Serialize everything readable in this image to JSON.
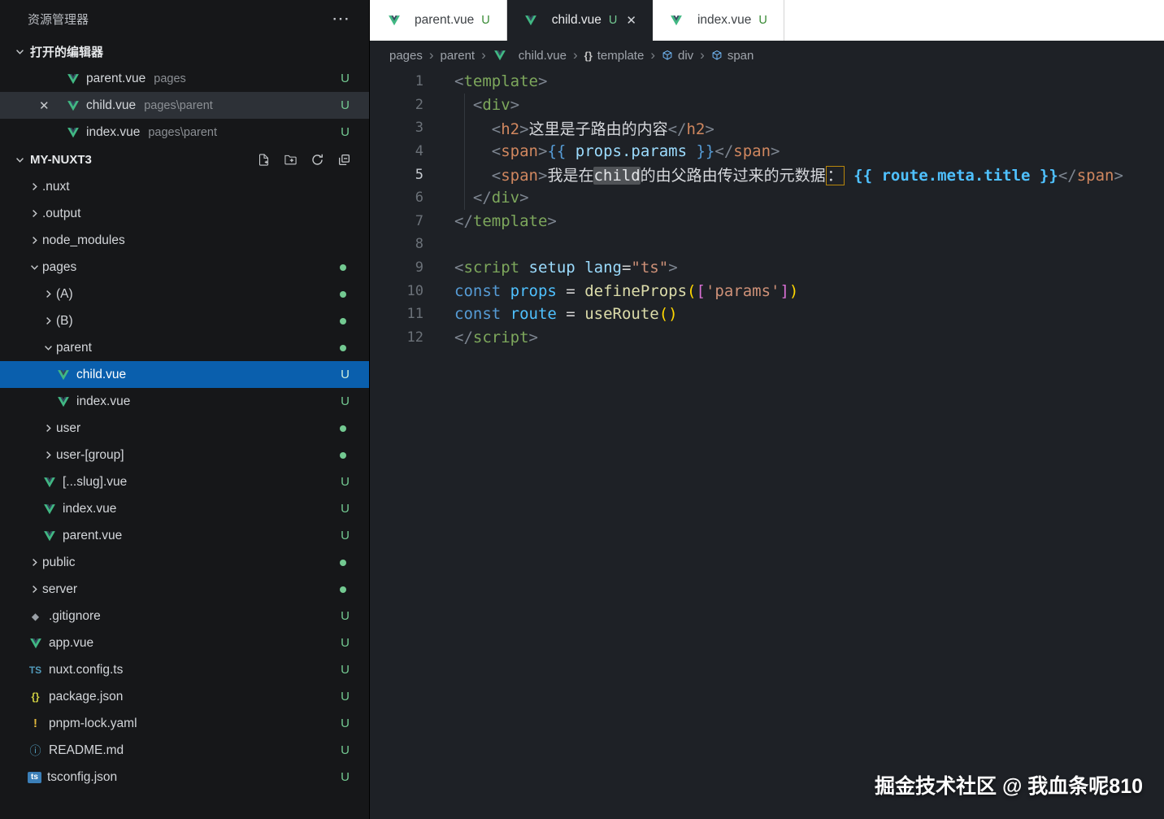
{
  "icons": {
    "close": "✕",
    "more": "⋯",
    "braces": "{}",
    "separator": "›"
  },
  "sidebar": {
    "title": "资源管理器",
    "open_editors": {
      "label": "打开的编辑器",
      "items": [
        {
          "file": "parent.vue",
          "path": "pages",
          "badge": "U",
          "selected": false
        },
        {
          "file": "child.vue",
          "path": "pages\\parent",
          "badge": "U",
          "selected": true
        },
        {
          "file": "index.vue",
          "path": "pages\\parent",
          "badge": "U",
          "selected": false
        }
      ]
    },
    "project": {
      "label": "MY-NUXT3",
      "actions": [
        "new-file-icon",
        "new-folder-icon",
        "refresh-icon",
        "collapse-all-icon"
      ],
      "tree": [
        {
          "label": ".nuxt",
          "kind": "folder",
          "expanded": false,
          "indent": 0
        },
        {
          "label": ".output",
          "kind": "folder",
          "expanded": false,
          "indent": 0
        },
        {
          "label": "node_modules",
          "kind": "folder",
          "expanded": false,
          "indent": 0
        },
        {
          "label": "pages",
          "kind": "folder",
          "expanded": true,
          "indent": 0,
          "badge": "dot"
        },
        {
          "label": "(A)",
          "kind": "folder",
          "expanded": false,
          "indent": 1,
          "badge": "dot"
        },
        {
          "label": "(B)",
          "kind": "folder",
          "expanded": false,
          "indent": 1,
          "badge": "dot"
        },
        {
          "label": "parent",
          "kind": "folder",
          "expanded": true,
          "indent": 1,
          "badge": "dot"
        },
        {
          "label": "child.vue",
          "kind": "file",
          "icon": "vue",
          "indent": 2,
          "badge": "U",
          "selected": true
        },
        {
          "label": "index.vue",
          "kind": "file",
          "icon": "vue",
          "indent": 2,
          "badge": "U"
        },
        {
          "label": "user",
          "kind": "folder",
          "expanded": false,
          "indent": 1,
          "badge": "dot"
        },
        {
          "label": "user-[group]",
          "kind": "folder",
          "expanded": false,
          "indent": 1,
          "badge": "dot"
        },
        {
          "label": "[...slug].vue",
          "kind": "file",
          "icon": "vue",
          "indent": 1,
          "badge": "U"
        },
        {
          "label": "index.vue",
          "kind": "file",
          "icon": "vue",
          "indent": 1,
          "badge": "U"
        },
        {
          "label": "parent.vue",
          "kind": "file",
          "icon": "vue",
          "indent": 1,
          "badge": "U"
        },
        {
          "label": "public",
          "kind": "folder",
          "expanded": false,
          "indent": 0,
          "badge": "dot"
        },
        {
          "label": "server",
          "kind": "folder",
          "expanded": false,
          "indent": 0,
          "badge": "dot"
        },
        {
          "label": ".gitignore",
          "kind": "file",
          "icon": "git",
          "indent": 0,
          "badge": "U"
        },
        {
          "label": "app.vue",
          "kind": "file",
          "icon": "vue",
          "indent": 0,
          "badge": "U"
        },
        {
          "label": "nuxt.config.ts",
          "kind": "file",
          "icon": "ts",
          "indent": 0,
          "badge": "U"
        },
        {
          "label": "package.json",
          "kind": "file",
          "icon": "json",
          "indent": 0,
          "badge": "U"
        },
        {
          "label": "pnpm-lock.yaml",
          "kind": "file",
          "icon": "yaml",
          "indent": 0,
          "badge": "U"
        },
        {
          "label": "README.md",
          "kind": "file",
          "icon": "readme",
          "indent": 0,
          "badge": "U"
        },
        {
          "label": "tsconfig.json",
          "kind": "file",
          "icon": "tsconfig",
          "indent": 0,
          "badge": "U"
        }
      ]
    }
  },
  "tabs": [
    {
      "file": "parent.vue",
      "badge": "U",
      "active": false,
      "closable": false
    },
    {
      "file": "child.vue",
      "badge": "U",
      "active": true,
      "closable": true
    },
    {
      "file": "index.vue",
      "badge": "U",
      "active": false,
      "closable": false
    }
  ],
  "breadcrumb": [
    {
      "label": "pages"
    },
    {
      "label": "parent"
    },
    {
      "label": "child.vue",
      "icon": "vue"
    },
    {
      "label": "template",
      "icon": "symbol-namespace"
    },
    {
      "label": "div",
      "icon": "symbol-field"
    },
    {
      "label": "span",
      "icon": "symbol-field"
    }
  ],
  "editor": {
    "lines": [
      {
        "num": 1,
        "tokens": [
          [
            "punc",
            "<"
          ],
          [
            "tagA",
            "template"
          ],
          [
            "punc",
            ">"
          ]
        ]
      },
      {
        "num": 2,
        "tokens": [
          [
            "ws",
            "  "
          ],
          [
            "punc",
            "<"
          ],
          [
            "tagA",
            "div"
          ],
          [
            "punc",
            ">"
          ]
        ]
      },
      {
        "num": 3,
        "tokens": [
          [
            "ws",
            "    "
          ],
          [
            "punc",
            "<"
          ],
          [
            "tagB",
            "h2"
          ],
          [
            "punc",
            ">"
          ],
          [
            "text",
            "这里是子路由的内容"
          ],
          [
            "punc",
            "</"
          ],
          [
            "tagB",
            "h2"
          ],
          [
            "punc",
            ">"
          ]
        ]
      },
      {
        "num": 4,
        "tokens": [
          [
            "ws",
            "    "
          ],
          [
            "punc",
            "<"
          ],
          [
            "tagB",
            "span"
          ],
          [
            "punc",
            ">"
          ],
          [
            "interp",
            "{{"
          ],
          [
            "var",
            " props.params "
          ],
          [
            "interp",
            "}}"
          ],
          [
            "punc",
            "</"
          ],
          [
            "tagB",
            "span"
          ],
          [
            "punc",
            ">"
          ]
        ]
      },
      {
        "num": 5,
        "current": true,
        "tokens": [
          [
            "ws",
            "    "
          ],
          [
            "punc",
            "<"
          ],
          [
            "tagB",
            "span"
          ],
          [
            "punc",
            ">"
          ],
          [
            "text",
            "我是在"
          ],
          [
            "hl",
            "child"
          ],
          [
            "text",
            "的由父路由传过来的元数据"
          ],
          [
            "boxed",
            "："
          ],
          [
            "ws",
            " "
          ],
          [
            "bblue",
            "{{ route.meta.title }}"
          ],
          [
            "punc",
            "</"
          ],
          [
            "tagB",
            "span"
          ],
          [
            "punc",
            ">"
          ]
        ]
      },
      {
        "num": 6,
        "tokens": [
          [
            "ws",
            "  "
          ],
          [
            "punc",
            "</"
          ],
          [
            "tagA",
            "div"
          ],
          [
            "punc",
            ">"
          ]
        ]
      },
      {
        "num": 7,
        "tokens": [
          [
            "punc",
            "</"
          ],
          [
            "tagA",
            "template"
          ],
          [
            "punc",
            ">"
          ]
        ]
      },
      {
        "num": 8,
        "tokens": []
      },
      {
        "num": 9,
        "tokens": [
          [
            "punc",
            "<"
          ],
          [
            "tagA",
            "script"
          ],
          [
            "ws",
            " "
          ],
          [
            "attr",
            "setup"
          ],
          [
            "ws",
            " "
          ],
          [
            "attr",
            "lang"
          ],
          [
            "op",
            "="
          ],
          [
            "str",
            "\"ts\""
          ],
          [
            "punc",
            ">"
          ]
        ]
      },
      {
        "num": 10,
        "tokens": [
          [
            "kw",
            "const"
          ],
          [
            "ws",
            " "
          ],
          [
            "cvar",
            "props"
          ],
          [
            "op",
            " = "
          ],
          [
            "fn",
            "defineProps"
          ],
          [
            "br1",
            "("
          ],
          [
            "br2",
            "["
          ],
          [
            "str",
            "'params'"
          ],
          [
            "br2",
            "]"
          ],
          [
            "br1",
            ")"
          ]
        ]
      },
      {
        "num": 11,
        "tokens": [
          [
            "kw",
            "const"
          ],
          [
            "ws",
            " "
          ],
          [
            "cvar",
            "route"
          ],
          [
            "op",
            " = "
          ],
          [
            "fn",
            "useRoute"
          ],
          [
            "br1",
            "()"
          ]
        ]
      },
      {
        "num": 12,
        "tokens": [
          [
            "punc",
            "</"
          ],
          [
            "tagA",
            "script"
          ],
          [
            "punc",
            ">"
          ]
        ]
      }
    ]
  },
  "watermark": "掘金技术社区 @ 我血条呢810"
}
